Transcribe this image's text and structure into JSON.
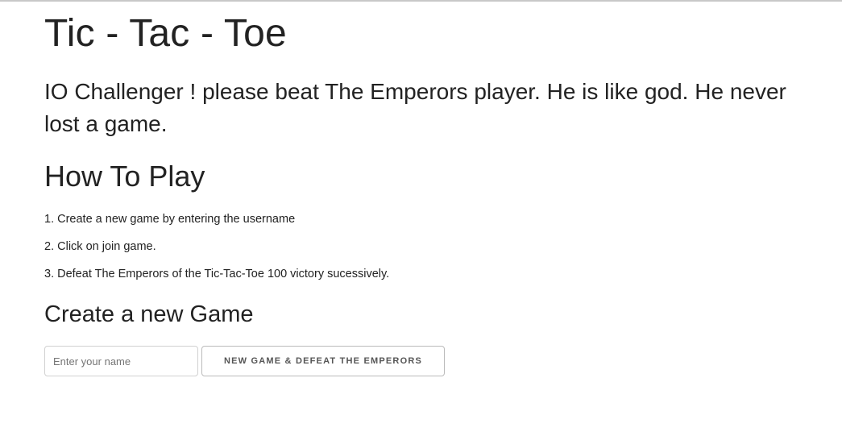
{
  "header": {
    "title": "Tic - Tac - Toe"
  },
  "intro": {
    "text": "IO Challenger ! please beat The Emperors player. He is like god. He never lost a game."
  },
  "how_to_play": {
    "title": "How To Play",
    "steps": [
      "1. Create a new game by entering the username",
      "2. Click on join game.",
      "3. Defeat The Emperors of the Tic-Tac-Toe 100 victory sucessively."
    ]
  },
  "create_game": {
    "title": "Create a new Game",
    "name_input": {
      "value": "",
      "placeholder": "Enter your name"
    },
    "submit_label": "NEW GAME & DEFEAT THE EMPERORS"
  }
}
